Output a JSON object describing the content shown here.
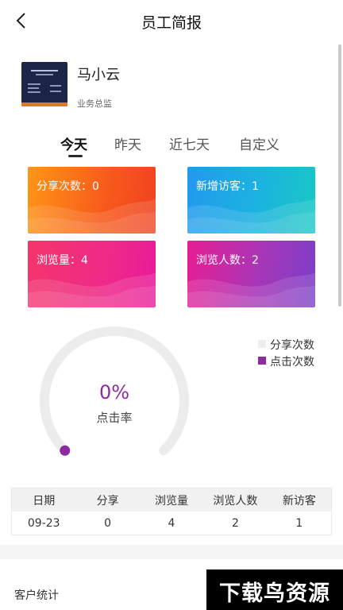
{
  "header": {
    "title": "员工简报",
    "back_icon": "chevron-left-icon"
  },
  "profile": {
    "name": "马小云",
    "role": "业务总监"
  },
  "tabs": [
    {
      "label": "今天",
      "active": true
    },
    {
      "label": "昨天",
      "active": false
    },
    {
      "label": "近七天",
      "active": false
    },
    {
      "label": "自定义",
      "active": false
    }
  ],
  "stats": [
    {
      "label": "分享次数：0"
    },
    {
      "label": "新增访客：1"
    },
    {
      "label": "浏览量：4"
    },
    {
      "label": "浏览人数：2"
    }
  ],
  "gauge": {
    "value": "0%",
    "label": "点击率",
    "fraction": 0,
    "track_color": "#ececec",
    "indicator_color": "#8e2aa0"
  },
  "legend": [
    {
      "label": "分享次数",
      "color": "#eeeeee"
    },
    {
      "label": "点击次数",
      "color": "#8e2aa0"
    }
  ],
  "table": {
    "headers": [
      "日期",
      "分享",
      "浏览量",
      "浏览人数",
      "新访客"
    ],
    "rows": [
      [
        "09-23",
        "0",
        "4",
        "2",
        "1"
      ]
    ]
  },
  "section": {
    "title": "客户统计"
  },
  "watermark": {
    "text": "下载鸟资源"
  }
}
